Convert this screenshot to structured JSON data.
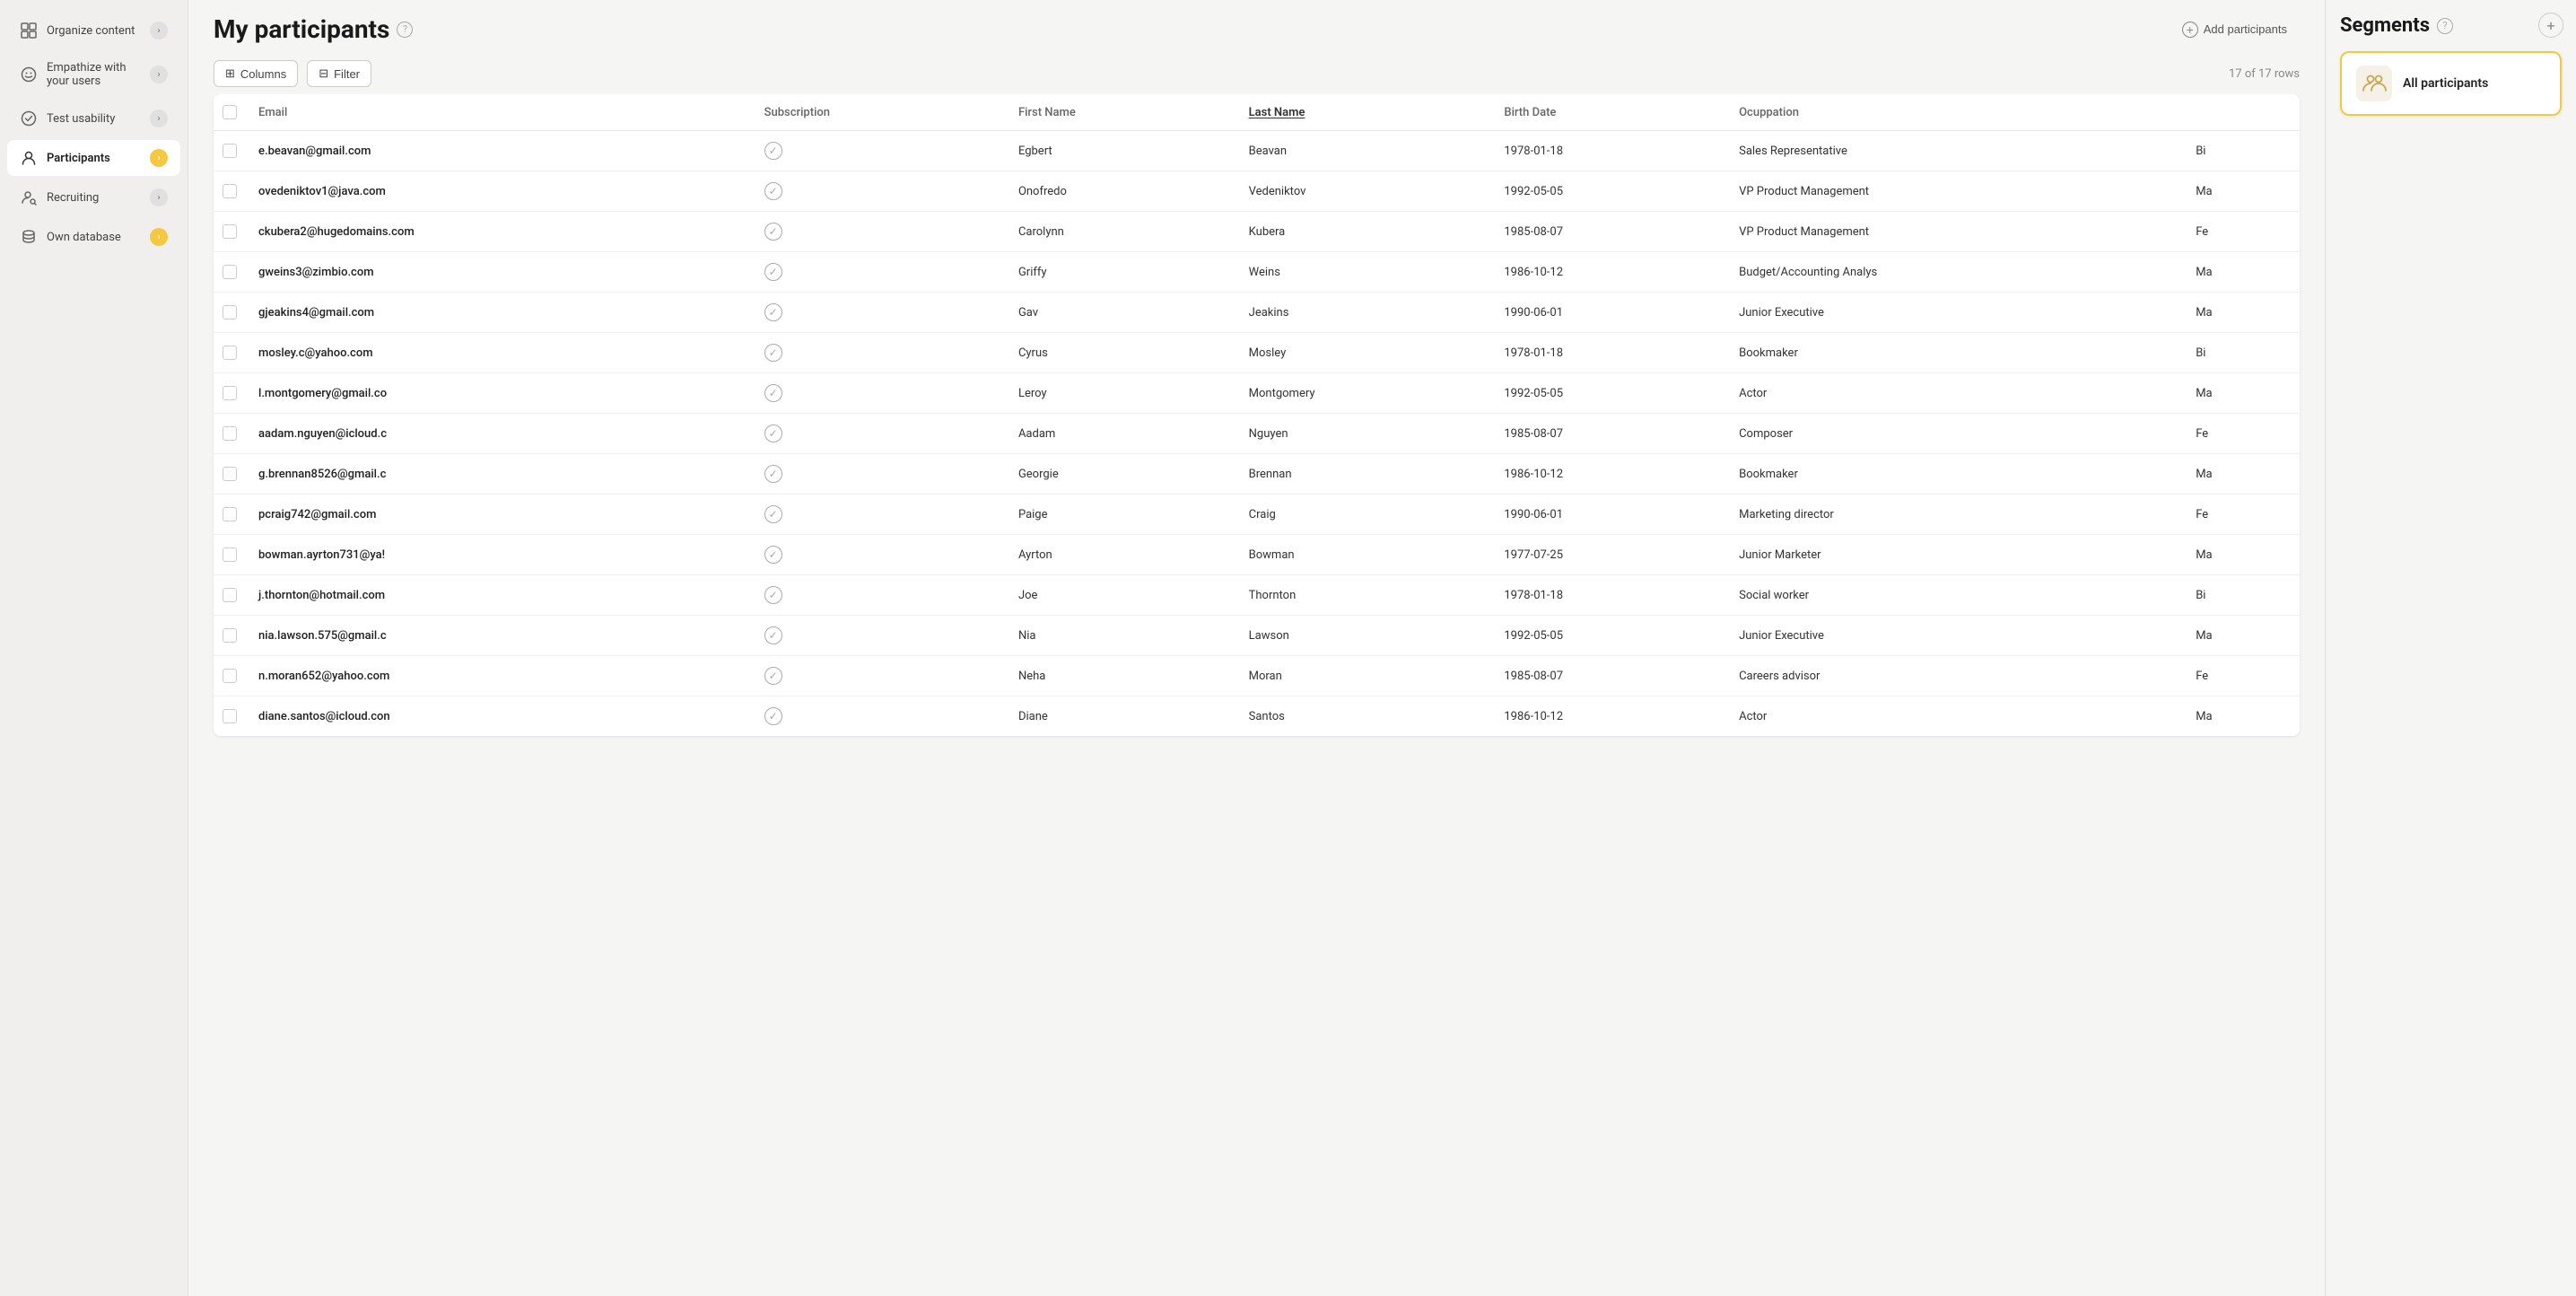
{
  "sidebar": {
    "items": [
      {
        "id": "organize-content",
        "label": "Organize content",
        "icon": "grid",
        "badge": "gray",
        "active": false
      },
      {
        "id": "empathize",
        "label": "Empathize with your users",
        "icon": "smile",
        "badge": "gray",
        "active": false
      },
      {
        "id": "test-usability",
        "label": "Test usability",
        "icon": "check-circle",
        "badge": "gray",
        "active": false
      },
      {
        "id": "participants",
        "label": "Participants",
        "icon": "user",
        "badge": "yellow",
        "active": true
      },
      {
        "id": "recruiting",
        "label": "Recruiting",
        "icon": "person-search",
        "badge": "gray",
        "active": false
      },
      {
        "id": "own-database",
        "label": "Own database",
        "icon": "database",
        "badge": "yellow-arrow",
        "active": false
      }
    ]
  },
  "header": {
    "title": "My participants",
    "add_button_label": "Add participants"
  },
  "toolbar": {
    "columns_label": "Columns",
    "filter_label": "Filter",
    "row_count": "17 of 17 rows"
  },
  "table": {
    "columns": [
      {
        "id": "email",
        "label": "Email",
        "sortable": false
      },
      {
        "id": "subscription",
        "label": "Subscription",
        "sortable": false
      },
      {
        "id": "first_name",
        "label": "First Name",
        "sortable": false
      },
      {
        "id": "last_name",
        "label": "Last Name",
        "sortable": true
      },
      {
        "id": "birth_date",
        "label": "Birth Date",
        "sortable": false
      },
      {
        "id": "occupation",
        "label": "Ocuppation",
        "sortable": false
      },
      {
        "id": "extra",
        "label": "",
        "sortable": false
      }
    ],
    "rows": [
      {
        "email": "e.beavan@gmail.com",
        "subscription": true,
        "first_name": "Egbert",
        "last_name": "Beavan",
        "birth_date": "1978-01-18",
        "occupation": "Sales Representative",
        "extra": "Bi"
      },
      {
        "email": "ovedeniktov1@java.com",
        "subscription": true,
        "first_name": "Onofredo",
        "last_name": "Vedeniktov",
        "birth_date": "1992-05-05",
        "occupation": "VP Product Management",
        "extra": "Ma"
      },
      {
        "email": "ckubera2@hugedomains.com",
        "subscription": true,
        "first_name": "Carolynn",
        "last_name": "Kubera",
        "birth_date": "1985-08-07",
        "occupation": "VP Product Management",
        "extra": "Fe"
      },
      {
        "email": "gweins3@zimbio.com",
        "subscription": true,
        "first_name": "Griffy",
        "last_name": "Weins",
        "birth_date": "1986-10-12",
        "occupation": "Budget/Accounting Analys",
        "extra": "Ma"
      },
      {
        "email": "gjeakins4@gmail.com",
        "subscription": true,
        "first_name": "Gav",
        "last_name": "Jeakins",
        "birth_date": "1990-06-01",
        "occupation": "Junior Executive",
        "extra": "Ma"
      },
      {
        "email": "mosley.c@yahoo.com",
        "subscription": true,
        "first_name": "Cyrus",
        "last_name": "Mosley",
        "birth_date": "1978-01-18",
        "occupation": "Bookmaker",
        "extra": "Bi"
      },
      {
        "email": "l.montgomery@gmail.co",
        "subscription": true,
        "first_name": "Leroy",
        "last_name": "Montgomery",
        "birth_date": "1992-05-05",
        "occupation": "Actor",
        "extra": "Ma"
      },
      {
        "email": "aadam.nguyen@icloud.c",
        "subscription": true,
        "first_name": "Aadam",
        "last_name": "Nguyen",
        "birth_date": "1985-08-07",
        "occupation": "Composer",
        "extra": "Fe"
      },
      {
        "email": "g.brennan8526@gmail.c",
        "subscription": true,
        "first_name": "Georgie",
        "last_name": "Brennan",
        "birth_date": "1986-10-12",
        "occupation": "Bookmaker",
        "extra": "Ma"
      },
      {
        "email": "pcraig742@gmail.com",
        "subscription": true,
        "first_name": "Paige",
        "last_name": "Craig",
        "birth_date": "1990-06-01",
        "occupation": "Marketing director",
        "extra": "Fe"
      },
      {
        "email": "bowman.ayrton731@ya!",
        "subscription": true,
        "first_name": "Ayrton",
        "last_name": "Bowman",
        "birth_date": "1977-07-25",
        "occupation": "Junior Marketer",
        "extra": "Ma"
      },
      {
        "email": "j.thornton@hotmail.com",
        "subscription": true,
        "first_name": "Joe",
        "last_name": "Thornton",
        "birth_date": "1978-01-18",
        "occupation": "Social worker",
        "extra": "Bi"
      },
      {
        "email": "nia.lawson.575@gmail.c",
        "subscription": true,
        "first_name": "Nia",
        "last_name": "Lawson",
        "birth_date": "1992-05-05",
        "occupation": "Junior Executive",
        "extra": "Ma"
      },
      {
        "email": "n.moran652@yahoo.com",
        "subscription": true,
        "first_name": "Neha",
        "last_name": "Moran",
        "birth_date": "1985-08-07",
        "occupation": "Careers advisor",
        "extra": "Fe"
      },
      {
        "email": "diane.santos@icloud.con",
        "subscription": true,
        "first_name": "Diane",
        "last_name": "Santos",
        "birth_date": "1986-10-12",
        "occupation": "Actor",
        "extra": "Ma"
      }
    ]
  },
  "segments": {
    "title": "Segments",
    "items": [
      {
        "id": "all-participants",
        "label": "All participants",
        "active": true
      }
    ]
  },
  "icons": {
    "help": "?",
    "add": "+",
    "columns": "⊞",
    "filter": "⊟",
    "check": "✓",
    "chevron_right": "›",
    "people": "⁂"
  }
}
